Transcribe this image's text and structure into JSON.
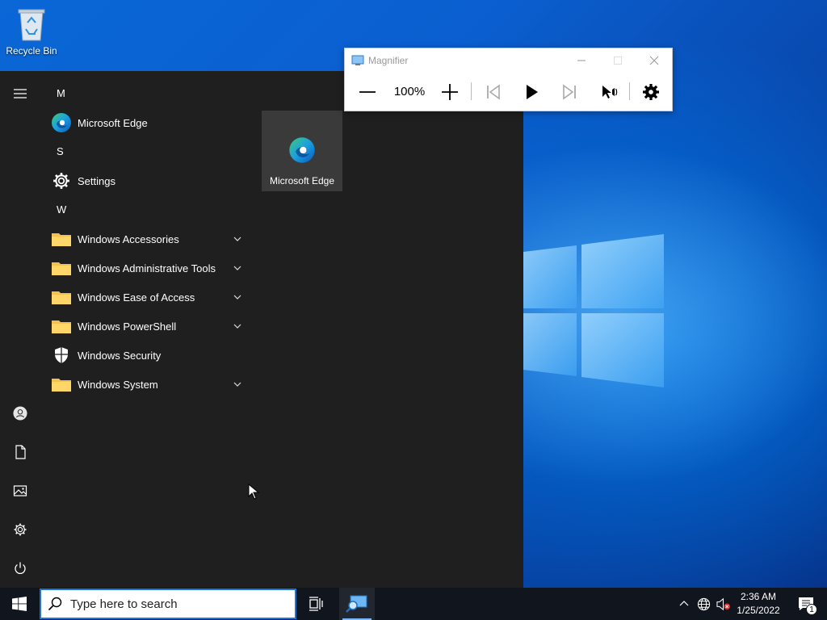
{
  "desktop": {
    "recycle_bin_label": "Recycle Bin"
  },
  "start_menu": {
    "groups": [
      {
        "letter": "M",
        "items": [
          {
            "label": "Microsoft Edge",
            "icon": "edge-icon",
            "expandable": false
          }
        ]
      },
      {
        "letter": "S",
        "items": [
          {
            "label": "Settings",
            "icon": "gear-icon",
            "expandable": false
          }
        ]
      },
      {
        "letter": "W",
        "items": [
          {
            "label": "Windows Accessories",
            "icon": "folder-icon",
            "expandable": true
          },
          {
            "label": "Windows Administrative Tools",
            "icon": "folder-icon",
            "expandable": true
          },
          {
            "label": "Windows Ease of Access",
            "icon": "folder-icon",
            "expandable": true
          },
          {
            "label": "Windows PowerShell",
            "icon": "folder-icon",
            "expandable": true
          },
          {
            "label": "Windows Security",
            "icon": "shield-icon",
            "expandable": false
          },
          {
            "label": "Windows System",
            "icon": "folder-icon",
            "expandable": true
          }
        ]
      }
    ],
    "tile": {
      "label": "Microsoft Edge",
      "icon": "edge-icon"
    },
    "rail": [
      "hamburger-icon",
      "user-icon",
      "documents-icon",
      "pictures-icon",
      "settings-icon",
      "power-icon"
    ]
  },
  "magnifier": {
    "title": "Magnifier",
    "zoom": "100%",
    "controls": [
      "zoom-out-icon",
      "zoom-in-icon",
      "previous-icon",
      "play-icon",
      "next-icon",
      "read-from-here-icon",
      "settings-icon"
    ]
  },
  "taskbar": {
    "search_placeholder": "Type here to search",
    "time": "2:36 AM",
    "date": "1/25/2022",
    "notification_count": "1"
  },
  "colors": {
    "start_bg": "#1f1f1f",
    "tile_bg": "#3a3a3a",
    "taskbar_bg": "#10151e",
    "folder": "#f4c04e",
    "accent": "#1b74d6"
  }
}
